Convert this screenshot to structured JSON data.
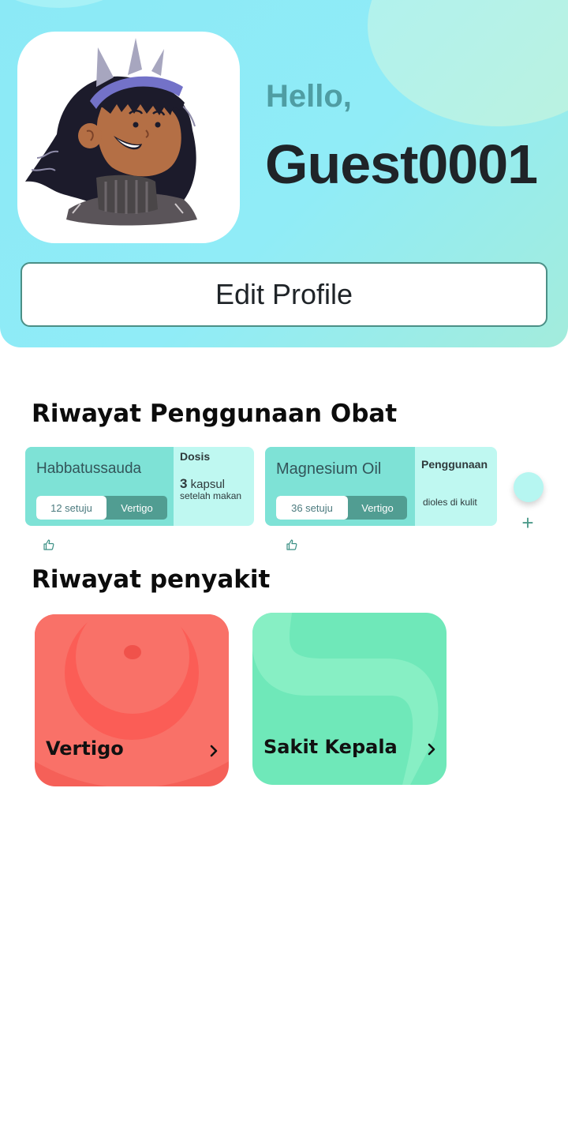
{
  "profile": {
    "greeting": "Hello,",
    "username": "Guest0001",
    "edit_label": "Edit Profile"
  },
  "medicine_history": {
    "title": "Riwayat Penggunaan Obat",
    "items": [
      {
        "name": "Habbatussauda",
        "likes": "12 setuju",
        "tag": "Vertigo",
        "detail_heading": "Dosis",
        "detail_count": "3",
        "detail_unit": "kapsul",
        "detail_note": "setelah makan"
      },
      {
        "name": "Magnesium Oil",
        "likes": "36 setuju",
        "tag": "Vertigo",
        "detail_heading": "Penggunaan",
        "detail_note": "dioles di kulit"
      }
    ],
    "add_symbol": "+"
  },
  "disease_history": {
    "title": "Riwayat penyakit",
    "items": [
      {
        "label": "Vertigo",
        "color": "#f97168"
      },
      {
        "label": "Sakit Kepala",
        "color": "#6fe8b9"
      }
    ]
  },
  "icons": [
    "avatar-illustration",
    "thumbs-up-icon",
    "plus-icon",
    "chevron-right-icon"
  ]
}
